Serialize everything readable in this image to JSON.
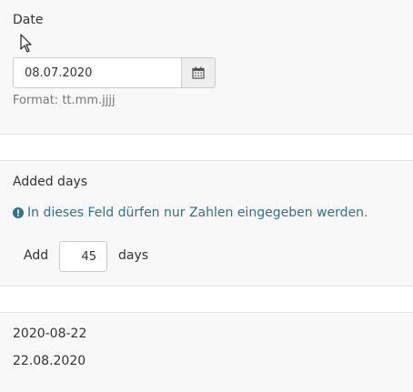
{
  "date_field": {
    "label": "Date",
    "value": "08.07.2020",
    "format_hint": "Format: tt.mm.jjjj"
  },
  "added_days": {
    "label": "Added days",
    "info_message": "In dieses Feld dürfen nur Zahlen eingegeben werden.",
    "prefix": "Add",
    "value": "45",
    "suffix": "days"
  },
  "results": {
    "iso_date": "2020-08-22",
    "local_date": "22.08.2020"
  },
  "colors": {
    "info": "#31708f",
    "background": "#f8f8f8",
    "band": "#ffffff",
    "border": "#cccccc"
  },
  "icons": {
    "calendar": "calendar-icon",
    "info": "info-circle-icon",
    "cursor": "mouse-pointer-icon"
  }
}
